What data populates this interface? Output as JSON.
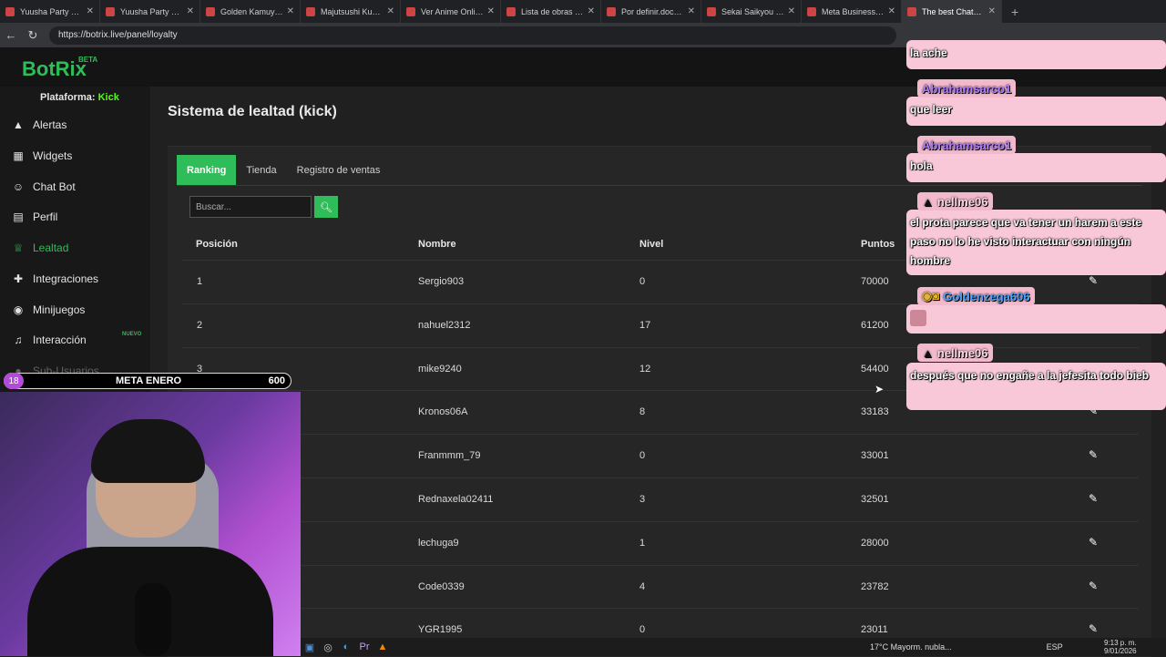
{
  "browser": {
    "tabs": [
      {
        "label": "Yuusha Party wo Oidasa"
      },
      {
        "label": "Yuusha Party ni Kawai"
      },
      {
        "label": "Golden Kamuy: Saishu"
      },
      {
        "label": "Majutsushi Kunon wa"
      },
      {
        "label": "Ver Anime Online - T"
      },
      {
        "label": "Lista de obras en se"
      },
      {
        "label": "Por definir.docx - Do"
      },
      {
        "label": "Sekai Saikyou no Ko"
      },
      {
        "label": "Meta Business Suite"
      },
      {
        "label": "The best ChatBot ar"
      }
    ],
    "url": "https://botrix.live/panel/loyalty"
  },
  "app": {
    "logo": "BotRix",
    "logo_badge": "BETA",
    "platform_label": "Plataforma:",
    "platform_value": "Kick",
    "nuevo_badge": "NUEVO",
    "sidebar": [
      {
        "label": "Alertas",
        "icon": "warning-icon",
        "glyph": "▲"
      },
      {
        "label": "Widgets",
        "icon": "grid-icon",
        "glyph": "▦"
      },
      {
        "label": "Chat Bot",
        "icon": "robot-icon",
        "glyph": "☺"
      },
      {
        "label": "Perfil",
        "icon": "id-card-icon",
        "glyph": "▤"
      },
      {
        "label": "Lealtad",
        "icon": "trophy-icon",
        "glyph": "♕"
      },
      {
        "label": "Integraciones",
        "icon": "puzzle-icon",
        "glyph": "✚"
      },
      {
        "label": "Minijuegos",
        "icon": "gamepad-icon",
        "glyph": "◉"
      },
      {
        "label": "Interacción",
        "icon": "music-icon",
        "glyph": "♫"
      },
      {
        "label": "Sub-Usuarios",
        "icon": "users-icon",
        "glyph": "●"
      }
    ],
    "page_title": "Sistema de lealtad (kick)",
    "tabs": [
      "Ranking",
      "Tienda",
      "Registro de ventas"
    ],
    "search_placeholder": "Buscar...",
    "columns": {
      "pos": "Posición",
      "name": "Nombre",
      "level": "Nivel",
      "points": "Puntos"
    },
    "rows": [
      {
        "pos": "1",
        "name": "Sergio903",
        "level": "0",
        "points": "70000"
      },
      {
        "pos": "2",
        "name": "nahuel2312",
        "level": "17",
        "points": "61200"
      },
      {
        "pos": "3",
        "name": "mike9240",
        "level": "12",
        "points": "54400"
      },
      {
        "pos": "",
        "name": "Kronos06A",
        "level": "8",
        "points": "33183"
      },
      {
        "pos": "",
        "name": "Franmmm_79",
        "level": "0",
        "points": "33001"
      },
      {
        "pos": "",
        "name": "Rednaxela02411",
        "level": "3",
        "points": "32501"
      },
      {
        "pos": "",
        "name": "lechuga9",
        "level": "1",
        "points": "28000"
      },
      {
        "pos": "",
        "name": "Code0339",
        "level": "4",
        "points": "23782"
      },
      {
        "pos": "",
        "name": "YGR1995",
        "level": "0",
        "points": "23011"
      }
    ]
  },
  "overlay": {
    "goal_count": "18",
    "goal_label": "META ENERO",
    "goal_value": "600"
  },
  "chat": [
    {
      "user": "",
      "message": "la ache"
    },
    {
      "user": "Abrahamsarco1",
      "message": "que leer"
    },
    {
      "user": "Abrahamsarco1",
      "message": "hola"
    },
    {
      "user": "nellme06",
      "message": "el prota parece que va tener un harem a este paso no lo he visto interactuar con ningún hombre"
    },
    {
      "user": "Goldenzega606",
      "message": ""
    },
    {
      "user": "nellme06",
      "message": "después que no engañe a la jefesita todo bieb"
    }
  ],
  "taskbar": {
    "weather": "17°C  Mayorm. nubla...",
    "lang": "ESP",
    "time": "9:13 p. m.",
    "date": "9/01/2026"
  }
}
